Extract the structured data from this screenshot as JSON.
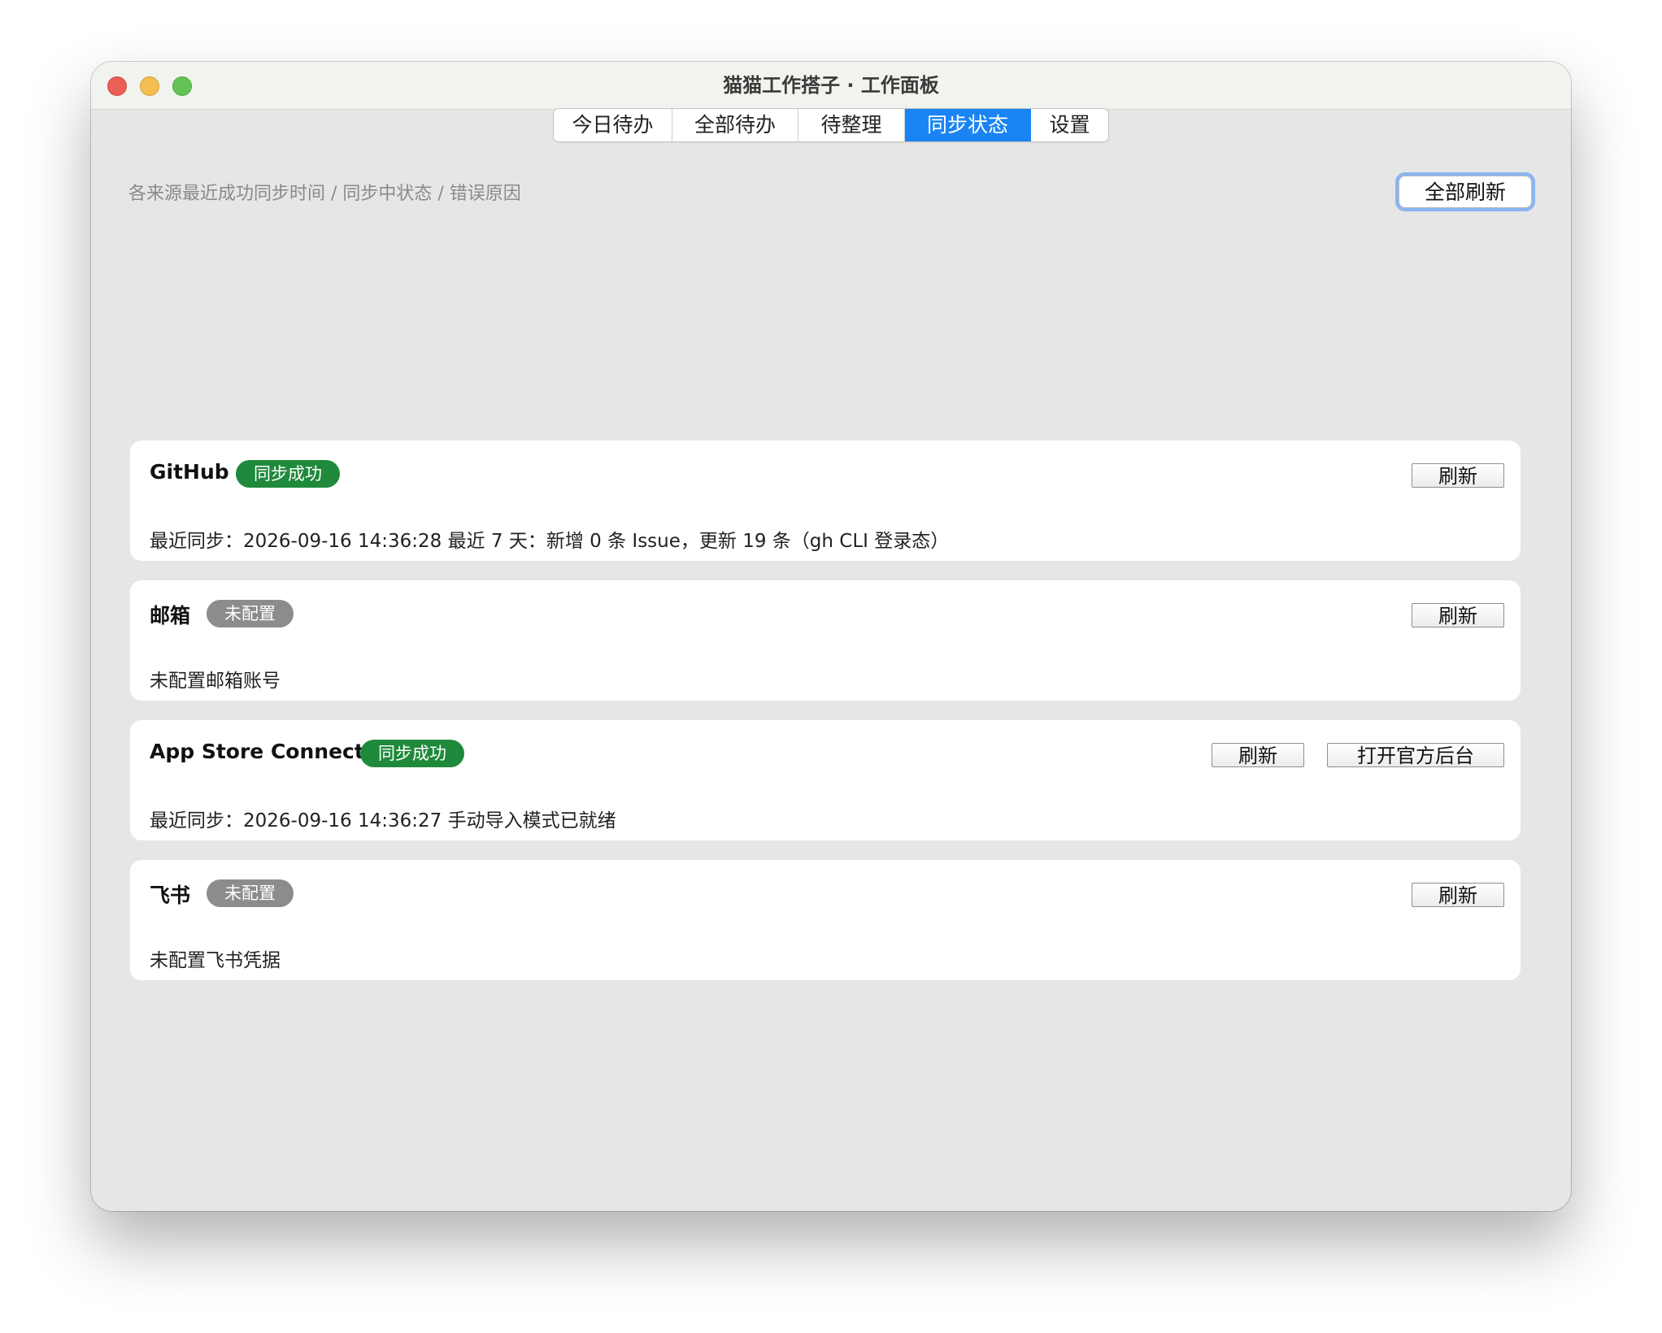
{
  "window": {
    "title": "猫猫工作搭子 · 工作面板"
  },
  "tabs": [
    {
      "label": "今日待办",
      "active": false
    },
    {
      "label": "全部待办",
      "active": false
    },
    {
      "label": "待整理",
      "active": false
    },
    {
      "label": "同步状态",
      "active": true
    },
    {
      "label": "设置",
      "active": false
    }
  ],
  "header": {
    "subtitle": "各来源最近成功同步时间 / 同步中状态 / 错误原因",
    "refresh_all_label": "全部刷新"
  },
  "sources": [
    {
      "name": "GitHub",
      "status": "同步成功",
      "status_color": "#1f8a3b",
      "detail": "最近同步：2026-09-16 14:36:28   最近 7 天：新增 0 条 Issue，更新 19 条（gh CLI 登录态）",
      "refresh_label": "刷新"
    },
    {
      "name": "邮箱",
      "status": "未配置",
      "status_color": "#8c8c8c",
      "detail": "未配置邮箱账号",
      "refresh_label": "刷新"
    },
    {
      "name": "App Store Connect",
      "status": "同步成功",
      "status_color": "#1f8a3b",
      "detail": "最近同步：2026-09-16 14:36:27   手动导入模式已就绪",
      "refresh_label": "刷新",
      "open_console_label": "打开官方后台"
    },
    {
      "name": "飞书",
      "status": "未配置",
      "status_color": "#8c8c8c",
      "detail": "未配置飞书凭据",
      "refresh_label": "刷新"
    }
  ],
  "colors": {
    "accent": "#1a84f4",
    "success": "#1f8a3b",
    "neutral": "#8c8c8c"
  }
}
